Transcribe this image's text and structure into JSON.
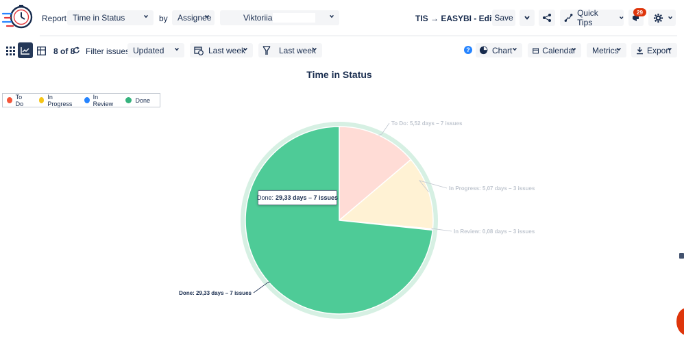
{
  "header": {
    "report_label": "Report:",
    "report_value": "Time in Status",
    "by_label": "by",
    "group_value": "Assignee",
    "user_value": "Viktoriia",
    "breadcrumb": "TIS → EASYBI - Edited",
    "save_label": "Save",
    "quick_tips_label": "Quick Tips",
    "notification_count": "29"
  },
  "toolbar": {
    "count_value": "8 of 8",
    "filter_label": "Filter issues:",
    "filter_value": "Updated",
    "date_range_1": "Last week",
    "date_range_2": "Last week",
    "chart_label": "Chart",
    "calendar_label": "Calendar",
    "metrics_label": "Metrics",
    "export_label": "Export"
  },
  "chart_data": {
    "type": "pie",
    "title": "Time in Status",
    "legend": [
      "To Do",
      "In Progress",
      "In Review",
      "Done"
    ],
    "legend_colors": [
      "#f5563a",
      "#f5c518",
      "#2684ff",
      "#36b37e"
    ],
    "slices": [
      {
        "name": "To Do",
        "days": 5.52,
        "issues": 7,
        "label": "To Do: 5,52 days – 7 issues",
        "color": "#ffdcd6"
      },
      {
        "name": "In Progress",
        "days": 5.07,
        "issues": 3,
        "label": "In Progress: 5,07 days – 3 issues",
        "color": "#fff2d4"
      },
      {
        "name": "In Review",
        "days": 0.08,
        "issues": 3,
        "label": "In Review: 0,08 days – 3 issues",
        "color": "#dbeafe"
      },
      {
        "name": "Done",
        "days": 29.33,
        "issues": 7,
        "label": "Done: 29,33 days – 7 issues",
        "color": "#4ecb97"
      }
    ],
    "tooltip_prefix": "Done:",
    "tooltip_value": "29,33 days – 7 issues"
  },
  "colors": {
    "accent": "#0052cc",
    "badge": "#de350b"
  }
}
